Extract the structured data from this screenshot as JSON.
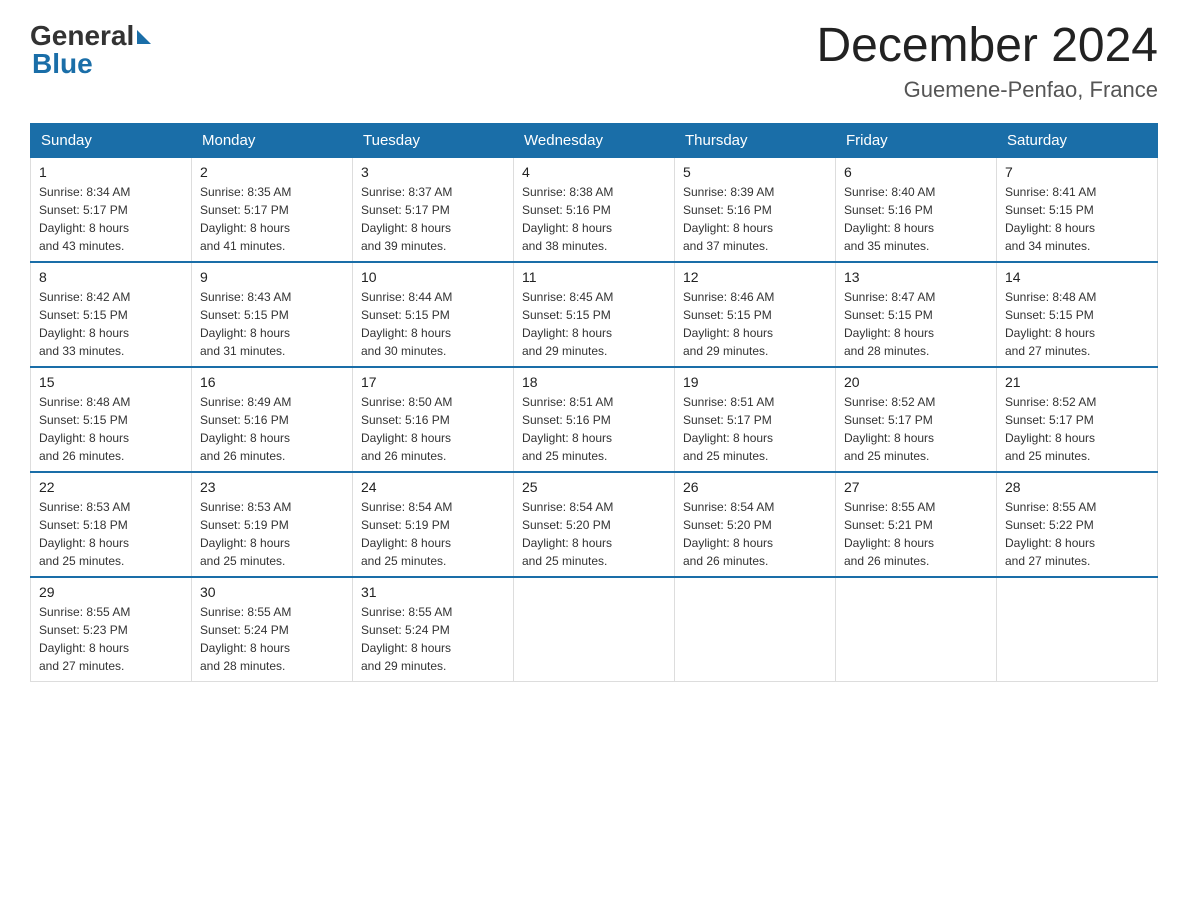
{
  "header": {
    "logo_general": "General",
    "logo_blue": "Blue",
    "month_title": "December 2024",
    "location": "Guemene-Penfao, France"
  },
  "days_of_week": [
    "Sunday",
    "Monday",
    "Tuesday",
    "Wednesday",
    "Thursday",
    "Friday",
    "Saturday"
  ],
  "weeks": [
    [
      {
        "day": "1",
        "sunrise": "8:34 AM",
        "sunset": "5:17 PM",
        "daylight": "8 hours and 43 minutes."
      },
      {
        "day": "2",
        "sunrise": "8:35 AM",
        "sunset": "5:17 PM",
        "daylight": "8 hours and 41 minutes."
      },
      {
        "day": "3",
        "sunrise": "8:37 AM",
        "sunset": "5:17 PM",
        "daylight": "8 hours and 39 minutes."
      },
      {
        "day": "4",
        "sunrise": "8:38 AM",
        "sunset": "5:16 PM",
        "daylight": "8 hours and 38 minutes."
      },
      {
        "day": "5",
        "sunrise": "8:39 AM",
        "sunset": "5:16 PM",
        "daylight": "8 hours and 37 minutes."
      },
      {
        "day": "6",
        "sunrise": "8:40 AM",
        "sunset": "5:16 PM",
        "daylight": "8 hours and 35 minutes."
      },
      {
        "day": "7",
        "sunrise": "8:41 AM",
        "sunset": "5:15 PM",
        "daylight": "8 hours and 34 minutes."
      }
    ],
    [
      {
        "day": "8",
        "sunrise": "8:42 AM",
        "sunset": "5:15 PM",
        "daylight": "8 hours and 33 minutes."
      },
      {
        "day": "9",
        "sunrise": "8:43 AM",
        "sunset": "5:15 PM",
        "daylight": "8 hours and 31 minutes."
      },
      {
        "day": "10",
        "sunrise": "8:44 AM",
        "sunset": "5:15 PM",
        "daylight": "8 hours and 30 minutes."
      },
      {
        "day": "11",
        "sunrise": "8:45 AM",
        "sunset": "5:15 PM",
        "daylight": "8 hours and 29 minutes."
      },
      {
        "day": "12",
        "sunrise": "8:46 AM",
        "sunset": "5:15 PM",
        "daylight": "8 hours and 29 minutes."
      },
      {
        "day": "13",
        "sunrise": "8:47 AM",
        "sunset": "5:15 PM",
        "daylight": "8 hours and 28 minutes."
      },
      {
        "day": "14",
        "sunrise": "8:48 AM",
        "sunset": "5:15 PM",
        "daylight": "8 hours and 27 minutes."
      }
    ],
    [
      {
        "day": "15",
        "sunrise": "8:48 AM",
        "sunset": "5:15 PM",
        "daylight": "8 hours and 26 minutes."
      },
      {
        "day": "16",
        "sunrise": "8:49 AM",
        "sunset": "5:16 PM",
        "daylight": "8 hours and 26 minutes."
      },
      {
        "day": "17",
        "sunrise": "8:50 AM",
        "sunset": "5:16 PM",
        "daylight": "8 hours and 26 minutes."
      },
      {
        "day": "18",
        "sunrise": "8:51 AM",
        "sunset": "5:16 PM",
        "daylight": "8 hours and 25 minutes."
      },
      {
        "day": "19",
        "sunrise": "8:51 AM",
        "sunset": "5:17 PM",
        "daylight": "8 hours and 25 minutes."
      },
      {
        "day": "20",
        "sunrise": "8:52 AM",
        "sunset": "5:17 PM",
        "daylight": "8 hours and 25 minutes."
      },
      {
        "day": "21",
        "sunrise": "8:52 AM",
        "sunset": "5:17 PM",
        "daylight": "8 hours and 25 minutes."
      }
    ],
    [
      {
        "day": "22",
        "sunrise": "8:53 AM",
        "sunset": "5:18 PM",
        "daylight": "8 hours and 25 minutes."
      },
      {
        "day": "23",
        "sunrise": "8:53 AM",
        "sunset": "5:19 PM",
        "daylight": "8 hours and 25 minutes."
      },
      {
        "day": "24",
        "sunrise": "8:54 AM",
        "sunset": "5:19 PM",
        "daylight": "8 hours and 25 minutes."
      },
      {
        "day": "25",
        "sunrise": "8:54 AM",
        "sunset": "5:20 PM",
        "daylight": "8 hours and 25 minutes."
      },
      {
        "day": "26",
        "sunrise": "8:54 AM",
        "sunset": "5:20 PM",
        "daylight": "8 hours and 26 minutes."
      },
      {
        "day": "27",
        "sunrise": "8:55 AM",
        "sunset": "5:21 PM",
        "daylight": "8 hours and 26 minutes."
      },
      {
        "day": "28",
        "sunrise": "8:55 AM",
        "sunset": "5:22 PM",
        "daylight": "8 hours and 27 minutes."
      }
    ],
    [
      {
        "day": "29",
        "sunrise": "8:55 AM",
        "sunset": "5:23 PM",
        "daylight": "8 hours and 27 minutes."
      },
      {
        "day": "30",
        "sunrise": "8:55 AM",
        "sunset": "5:24 PM",
        "daylight": "8 hours and 28 minutes."
      },
      {
        "day": "31",
        "sunrise": "8:55 AM",
        "sunset": "5:24 PM",
        "daylight": "8 hours and 29 minutes."
      },
      null,
      null,
      null,
      null
    ]
  ],
  "labels": {
    "sunrise": "Sunrise:",
    "sunset": "Sunset:",
    "daylight": "Daylight:"
  }
}
